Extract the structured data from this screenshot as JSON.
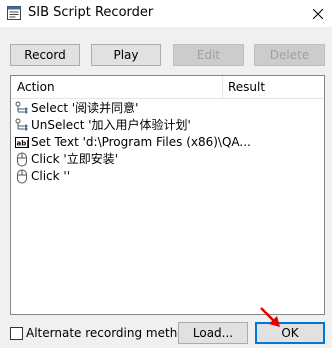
{
  "window": {
    "title": "SIB Script Recorder",
    "close_glyph": "✕"
  },
  "toolbar": {
    "record_label": "Record",
    "play_label": "Play",
    "edit_label": "Edit",
    "delete_label": "Delete"
  },
  "list": {
    "columns": {
      "action": "Action",
      "result": "Result"
    },
    "rows": [
      {
        "icon": "tree-select-icon",
        "text": "Select '阅读并同意'"
      },
      {
        "icon": "tree-select-icon",
        "text": "UnSelect '加入用户体验计划'"
      },
      {
        "icon": "text-field-icon",
        "text": "Set Text 'd:\\Program Files (x86)\\QA..."
      },
      {
        "icon": "mouse-icon",
        "text": "Click '立即安装'"
      },
      {
        "icon": "mouse-icon",
        "text": "Click ''"
      }
    ]
  },
  "footer": {
    "alt_method_label": "Alternate recording method",
    "alt_method_checked": false,
    "load_label": "Load...",
    "ok_label": "OK"
  },
  "colors": {
    "accent": "#0078d7",
    "annotation_arrow": "#e00000"
  }
}
